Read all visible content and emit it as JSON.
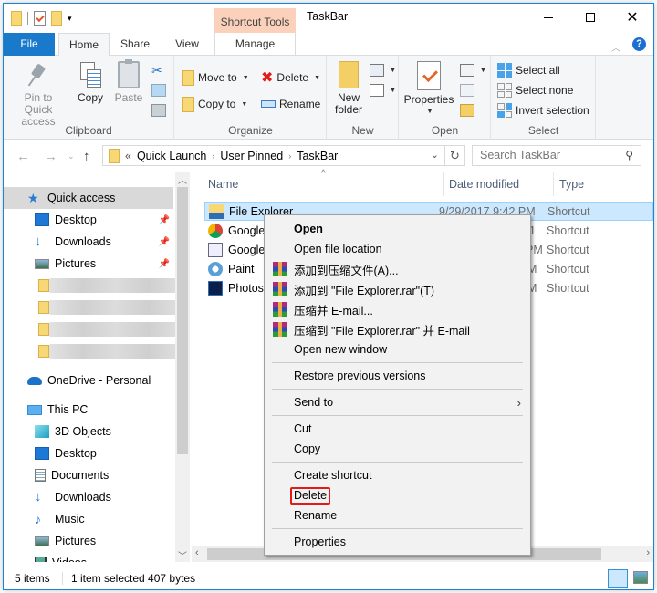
{
  "window": {
    "title": "TaskBar",
    "contextual_tab_group": "Shortcut Tools",
    "controls": {
      "minimize": "minimize",
      "maximize": "maximize",
      "close": "✕"
    }
  },
  "tabs": [
    {
      "label": "File"
    },
    {
      "label": "Home"
    },
    {
      "label": "Share"
    },
    {
      "label": "View"
    },
    {
      "label": "Manage"
    }
  ],
  "ribbon": {
    "clipboard": {
      "label": "Clipboard",
      "pin": "Pin to Quick access",
      "copy": "Copy",
      "paste": "Paste"
    },
    "organize": {
      "label": "Organize",
      "move_to": "Move to",
      "copy_to": "Copy to",
      "delete": "Delete",
      "rename": "Rename"
    },
    "new": {
      "label": "New",
      "new_folder_line1": "New",
      "new_folder_line2": "folder"
    },
    "open": {
      "label": "Open",
      "properties": "Properties"
    },
    "select": {
      "label": "Select",
      "select_all": "Select all",
      "select_none": "Select none",
      "invert": "Invert selection"
    }
  },
  "address": {
    "overflow": "«",
    "crumbs": [
      "Quick Launch",
      "User Pinned",
      "TaskBar"
    ],
    "search_placeholder": "Search TaskBar"
  },
  "navpane": {
    "quick_access": "Quick access",
    "quick_items": [
      "Desktop",
      "Downloads",
      "Pictures"
    ],
    "onedrive": "OneDrive - Personal",
    "this_pc": "This PC",
    "pc_items": [
      "3D Objects",
      "Desktop",
      "Documents",
      "Downloads",
      "Music",
      "Pictures",
      "Videos"
    ]
  },
  "filelist": {
    "columns": {
      "name": "Name",
      "date": "Date modified",
      "type": "Type"
    },
    "rows": [
      {
        "name": "File Explorer",
        "date": "9/29/2017 9:42 PM",
        "type": "Shortcut",
        "selected": true
      },
      {
        "name": "Google Chrome",
        "date": "",
        "type": "Shortcut"
      },
      {
        "name": "Google",
        "date": "",
        "type": "Shortcut"
      },
      {
        "name": "Paint",
        "date": "",
        "type": "Shortcut"
      },
      {
        "name": "Photoshop",
        "date": "",
        "type": "Shortcut"
      }
    ],
    "partial_dates": [
      "1",
      "PM",
      "M",
      "M"
    ]
  },
  "context_menu": {
    "open": "Open",
    "open_file_location": "Open file location",
    "rar_add_archive": "添加到压缩文件(A)...",
    "rar_add_named": "添加到 \"File Explorer.rar\"(T)",
    "rar_compress_email": "压缩并 E-mail...",
    "rar_compress_named_email": "压缩到 \"File Explorer.rar\" 并 E-mail",
    "open_new_window": "Open new window",
    "restore_previous": "Restore previous versions",
    "send_to": "Send to",
    "cut": "Cut",
    "copy": "Copy",
    "create_shortcut": "Create shortcut",
    "delete": "Delete",
    "rename": "Rename",
    "properties": "Properties"
  },
  "status": {
    "count": "5 items",
    "selection": "1 item selected  407 bytes"
  }
}
